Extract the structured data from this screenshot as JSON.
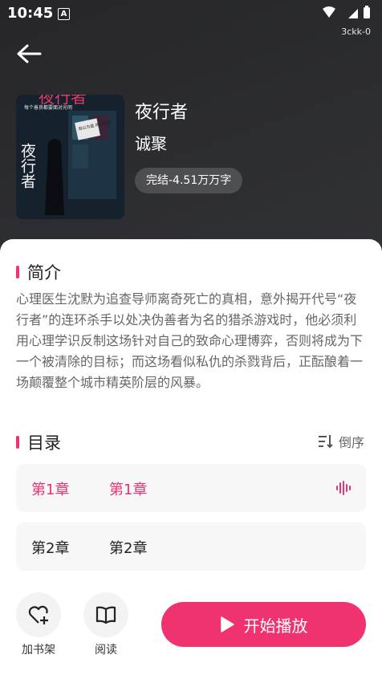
{
  "status_bar": {
    "time": "10:45",
    "indicator": "A",
    "device_tag": "3ckk-0"
  },
  "book": {
    "title": "夜行者",
    "author": "诚聚",
    "badge": "完结-4.51万万字",
    "cover": {
      "title_art": "夜行者",
      "subtitle_art": "每个善良都要面对光明",
      "note_art": "自以为是 所以无罪"
    }
  },
  "intro": {
    "title": "简介",
    "text": "心理医生沈默为追查导师离奇死亡的真相，意外揭开代号“夜行者”的连环杀手以处决伪善者为名的猎杀游戏时，他必须利用心理学识反制这场针对自己的致命心理博弈，否则将成为下一个被清除的目标；而这场看似私仇的杀戮背后，正酝酿着一场颠覆整个城市精英阶层的风暴。"
  },
  "catalog": {
    "title": "目录",
    "sort_label": "倒序",
    "chapters": [
      {
        "number": "第1章",
        "name": "第1章",
        "playing": true
      },
      {
        "number": "第2章",
        "name": "第2章",
        "playing": false
      }
    ]
  },
  "bottom": {
    "shelf_label": "加书架",
    "read_label": "阅读",
    "play_label": "开始播放"
  },
  "colors": {
    "accent": "#f0336e",
    "sheet": "#ffffff",
    "header_bg": "#2b2b2f"
  },
  "icons": {
    "back": "arrow-left-icon",
    "shelf": "heart-plus-icon",
    "read": "book-open-icon",
    "play": "play-icon",
    "sort": "sort-desc-icon",
    "wave": "audio-wave-icon"
  }
}
